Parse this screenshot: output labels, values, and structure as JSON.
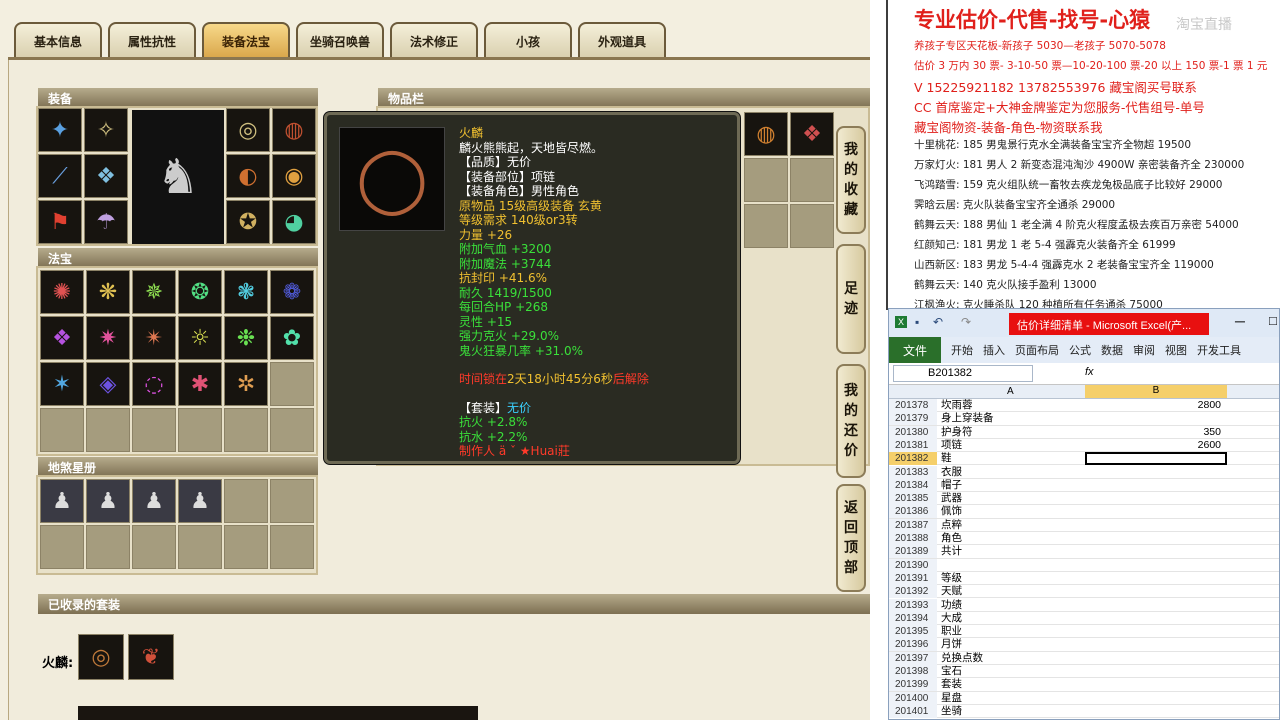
{
  "tabs": [
    "基本信息",
    "属性抗性",
    "装备法宝",
    "坐骑召唤兽",
    "法术修正",
    "小孩",
    "外观道具"
  ],
  "active_tab": 2,
  "panels": {
    "equip_label": "装备",
    "fabao_label": "法宝",
    "dishaxing_label": "地煞星册",
    "inventory_label": "物品栏",
    "suits_label": "已收录的套装",
    "suit_row_label": "火麟:"
  },
  "tooltip": {
    "name": "火麟",
    "desc": "麟火熊熊起，天地皆尽燃。",
    "quality": "【品质】无价",
    "slot": "【装备部位】项链",
    "role": "【装备角色】男性角色",
    "origin": "原物品 15级高级装备 玄黄",
    "level_req": "等级需求 140级or3转",
    "stats": [
      "力量 +26",
      "附加气血 +3200",
      "附加魔法 +3744",
      "抗封印 +41.6%",
      "耐久 1419/1500",
      "每回合HP +268",
      "灵性 +15",
      "强力克火 +29.0%",
      "鬼火狂暴几率 +31.0%"
    ],
    "time_prefix": "时间锁在",
    "time_value": "2天18小时45分6秒",
    "time_suffix": "后解除",
    "suit_key": "【套装】",
    "suit_value": "无价",
    "suit_stats": [
      "抗火 +2.8%",
      "抗水 +2.2%"
    ],
    "maker": "制作人 ä ˇ ★Huai莊"
  },
  "side_buttons": [
    [
      "我",
      "的",
      "收",
      "藏"
    ],
    [
      "足",
      "迹"
    ],
    [
      "我",
      "的",
      "还",
      "价"
    ],
    [
      "返",
      "回",
      "顶",
      "部"
    ]
  ],
  "notes": {
    "title": "专业估价-代售-找号-心猿",
    "watermark": "淘宝直播",
    "lines_red": [
      "养孩子专区天花板-新孩子 5030—老孩子 5070-5078",
      "估价 3 万内 30 票- 3-10-50 票—10-20-100 票-20 以上 150 票-1 票 1 元"
    ],
    "phone": "V 15225921182      13782553976    藏宝阁买号联系",
    "cc": "CC 首席鉴定+大神金牌鉴定为您服务-代售组号-单号",
    "cbg": "藏宝阁物资-装备-角色-物资联系我",
    "listings": [
      "十里桃花: 185 男鬼景行克水全满装备宝宝齐全物超 19500",
      "万家灯火: 181 男人 2 新变态混沌淘沙 4900W 亲密装备齐全 230000",
      "飞鸿踏雪: 159 克火组队统一畜牧去疾龙兔极品底子比较好 29000",
      "霁晗云居: 克火队装备宝宝齐全通杀 29000",
      "鹤舞云天: 188 男仙 1 老全满 4 阶克火程度孟极去疾百万亲密 54000",
      "红颜知己: 181 男龙 1 老 5-4 强霹克火装备齐全 61999",
      "山西新区: 183 男龙 5-4-4 强霹克水 2 老装备宝宝齐全 119000",
      "鹤舞云天: 140 克火队接手盈利 13000",
      "江枫渔火: 克火睡杀队 120 种植所有任务通杀 75000"
    ]
  },
  "excel": {
    "title": "估价详细清单 - Microsoft Excel(产...",
    "menu": [
      "文件",
      "开始",
      "插入",
      "页面布局",
      "公式",
      "数据",
      "审阅",
      "视图",
      "开发工具"
    ],
    "namebox": "B201382",
    "fx": "fx",
    "col_a": "A",
    "col_b": "B",
    "rows": [
      {
        "n": "201378",
        "a": "坎雨蓉",
        "b": "2800"
      },
      {
        "n": "201379",
        "a": "身上穿装备",
        "b": ""
      },
      {
        "n": "201380",
        "a": "护身符",
        "b": "350"
      },
      {
        "n": "201381",
        "a": "项链",
        "b": "2600"
      },
      {
        "n": "201382",
        "a": "鞋",
        "b": ""
      },
      {
        "n": "201383",
        "a": "衣服",
        "b": ""
      },
      {
        "n": "201384",
        "a": "帽子",
        "b": ""
      },
      {
        "n": "201385",
        "a": "武器",
        "b": ""
      },
      {
        "n": "201386",
        "a": "佩饰",
        "b": ""
      },
      {
        "n": "201387",
        "a": "点粹",
        "b": ""
      },
      {
        "n": "201388",
        "a": "角色",
        "b": ""
      },
      {
        "n": "201389",
        "a": "共计",
        "b": ""
      },
      {
        "n": "201390",
        "a": "",
        "b": ""
      },
      {
        "n": "201391",
        "a": "等级",
        "b": ""
      },
      {
        "n": "201392",
        "a": "天赋",
        "b": ""
      },
      {
        "n": "201393",
        "a": "功绩",
        "b": ""
      },
      {
        "n": "201394",
        "a": "大成",
        "b": ""
      },
      {
        "n": "201395",
        "a": "职业",
        "b": ""
      },
      {
        "n": "201396",
        "a": "月饼",
        "b": ""
      },
      {
        "n": "201397",
        "a": "兑换点数",
        "b": ""
      },
      {
        "n": "201398",
        "a": "宝石",
        "b": ""
      },
      {
        "n": "201399",
        "a": "套装",
        "b": ""
      },
      {
        "n": "201400",
        "a": "星盘",
        "b": ""
      },
      {
        "n": "201401",
        "a": "坐骑",
        "b": ""
      }
    ],
    "selected_row": "201382"
  }
}
